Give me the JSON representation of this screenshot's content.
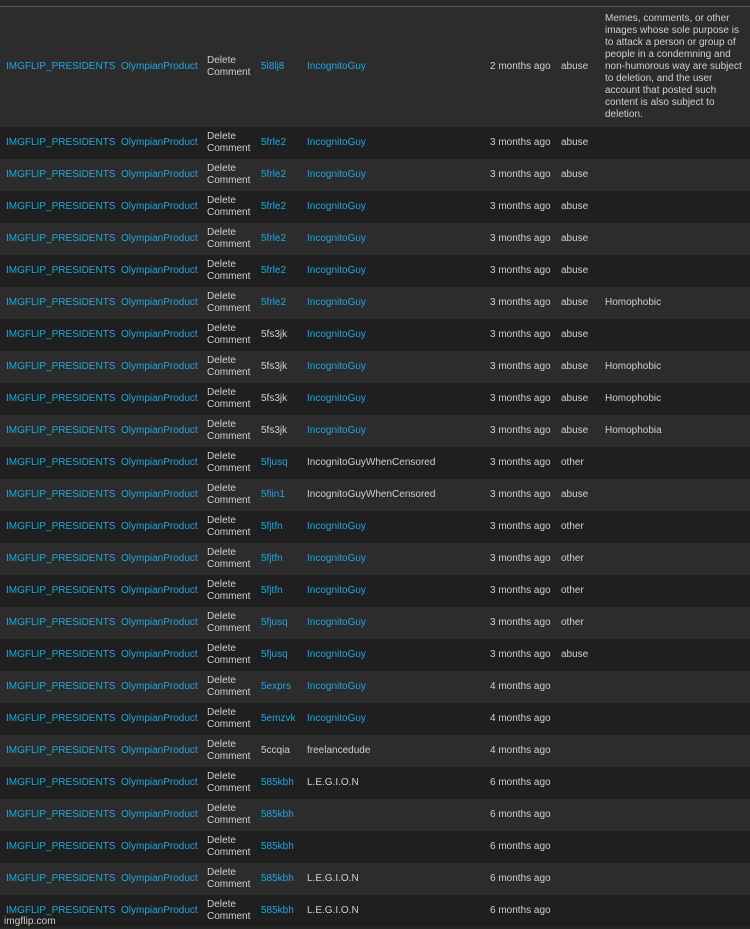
{
  "watermark": "imgflip.com",
  "rows": [
    {
      "stream": "IMGFLIP_PRESIDENTS",
      "mod": "OlympianProduct",
      "action": "Delete Comment",
      "post": "5l8lj8",
      "post_link": true,
      "author": "IncognitoGuy",
      "author_link": true,
      "time": "2 months ago",
      "type": "abuse",
      "reason": "Memes, comments, or other images whose sole purpose is to attack a person or group of people in a condemning and non-humorous way are subject to deletion, and the user account that posted such content is also subject to deletion."
    },
    {
      "stream": "IMGFLIP_PRESIDENTS",
      "mod": "OlympianProduct",
      "action": "Delete Comment",
      "post": "5frle2",
      "post_link": true,
      "author": "IncognitoGuy",
      "author_link": true,
      "time": "3 months ago",
      "type": "abuse",
      "reason": ""
    },
    {
      "stream": "IMGFLIP_PRESIDENTS",
      "mod": "OlympianProduct",
      "action": "Delete Comment",
      "post": "5frle2",
      "post_link": true,
      "author": "IncognitoGuy",
      "author_link": true,
      "time": "3 months ago",
      "type": "abuse",
      "reason": ""
    },
    {
      "stream": "IMGFLIP_PRESIDENTS",
      "mod": "OlympianProduct",
      "action": "Delete Comment",
      "post": "5frle2",
      "post_link": true,
      "author": "IncognitoGuy",
      "author_link": true,
      "time": "3 months ago",
      "type": "abuse",
      "reason": ""
    },
    {
      "stream": "IMGFLIP_PRESIDENTS",
      "mod": "OlympianProduct",
      "action": "Delete Comment",
      "post": "5frle2",
      "post_link": true,
      "author": "IncognitoGuy",
      "author_link": true,
      "time": "3 months ago",
      "type": "abuse",
      "reason": ""
    },
    {
      "stream": "IMGFLIP_PRESIDENTS",
      "mod": "OlympianProduct",
      "action": "Delete Comment",
      "post": "5frle2",
      "post_link": true,
      "author": "IncognitoGuy",
      "author_link": true,
      "time": "3 months ago",
      "type": "abuse",
      "reason": ""
    },
    {
      "stream": "IMGFLIP_PRESIDENTS",
      "mod": "OlympianProduct",
      "action": "Delete Comment",
      "post": "5frle2",
      "post_link": true,
      "author": "IncognitoGuy",
      "author_link": true,
      "time": "3 months ago",
      "type": "abuse",
      "reason": "Homophobic"
    },
    {
      "stream": "IMGFLIP_PRESIDENTS",
      "mod": "OlympianProduct",
      "action": "Delete Comment",
      "post": "5fs3jk",
      "post_link": false,
      "author": "IncognitoGuy",
      "author_link": true,
      "time": "3 months ago",
      "type": "abuse",
      "reason": ""
    },
    {
      "stream": "IMGFLIP_PRESIDENTS",
      "mod": "OlympianProduct",
      "action": "Delete Comment",
      "post": "5fs3jk",
      "post_link": false,
      "author": "IncognitoGuy",
      "author_link": true,
      "time": "3 months ago",
      "type": "abuse",
      "reason": "Homophobic"
    },
    {
      "stream": "IMGFLIP_PRESIDENTS",
      "mod": "OlympianProduct",
      "action": "Delete Comment",
      "post": "5fs3jk",
      "post_link": false,
      "author": "IncognitoGuy",
      "author_link": true,
      "time": "3 months ago",
      "type": "abuse",
      "reason": "Homophobic"
    },
    {
      "stream": "IMGFLIP_PRESIDENTS",
      "mod": "OlympianProduct",
      "action": "Delete Comment",
      "post": "5fs3jk",
      "post_link": false,
      "author": "IncognitoGuy",
      "author_link": true,
      "time": "3 months ago",
      "type": "abuse",
      "reason": "Homophobia"
    },
    {
      "stream": "IMGFLIP_PRESIDENTS",
      "mod": "OlympianProduct",
      "action": "Delete Comment",
      "post": "5fjusq",
      "post_link": true,
      "author": "IncognitoGuyWhenCensored",
      "author_link": false,
      "time": "3 months ago",
      "type": "other",
      "reason": ""
    },
    {
      "stream": "IMGFLIP_PRESIDENTS",
      "mod": "OlympianProduct",
      "action": "Delete Comment",
      "post": "5fiin1",
      "post_link": true,
      "author": "IncognitoGuyWhenCensored",
      "author_link": false,
      "time": "3 months ago",
      "type": "abuse",
      "reason": ""
    },
    {
      "stream": "IMGFLIP_PRESIDENTS",
      "mod": "OlympianProduct",
      "action": "Delete Comment",
      "post": "5fjtfn",
      "post_link": true,
      "author": "IncognitoGuy",
      "author_link": true,
      "time": "3 months ago",
      "type": "other",
      "reason": ""
    },
    {
      "stream": "IMGFLIP_PRESIDENTS",
      "mod": "OlympianProduct",
      "action": "Delete Comment",
      "post": "5fjtfn",
      "post_link": true,
      "author": "IncognitoGuy",
      "author_link": true,
      "time": "3 months ago",
      "type": "other",
      "reason": ""
    },
    {
      "stream": "IMGFLIP_PRESIDENTS",
      "mod": "OlympianProduct",
      "action": "Delete Comment",
      "post": "5fjtfn",
      "post_link": true,
      "author": "IncognitoGuy",
      "author_link": true,
      "time": "3 months ago",
      "type": "other",
      "reason": ""
    },
    {
      "stream": "IMGFLIP_PRESIDENTS",
      "mod": "OlympianProduct",
      "action": "Delete Comment",
      "post": "5fjusq",
      "post_link": true,
      "author": "IncognitoGuy",
      "author_link": true,
      "time": "3 months ago",
      "type": "other",
      "reason": ""
    },
    {
      "stream": "IMGFLIP_PRESIDENTS",
      "mod": "OlympianProduct",
      "action": "Delete Comment",
      "post": "5fjusq",
      "post_link": true,
      "author": "IncognitoGuy",
      "author_link": true,
      "time": "3 months ago",
      "type": "abuse",
      "reason": ""
    },
    {
      "stream": "IMGFLIP_PRESIDENTS",
      "mod": "OlympianProduct",
      "action": "Delete Comment",
      "post": "5exprs",
      "post_link": true,
      "author": "IncognitoGuy",
      "author_link": true,
      "time": "4 months ago",
      "type": "",
      "reason": ""
    },
    {
      "stream": "IMGFLIP_PRESIDENTS",
      "mod": "OlympianProduct",
      "action": "Delete Comment",
      "post": "5emzvk",
      "post_link": true,
      "author": "IncognitoGuy",
      "author_link": true,
      "time": "4 months ago",
      "type": "",
      "reason": ""
    },
    {
      "stream": "IMGFLIP_PRESIDENTS",
      "mod": "OlympianProduct",
      "action": "Delete Comment",
      "post": "5ccqia",
      "post_link": false,
      "author": "freelancedude",
      "author_link": false,
      "time": "4 months ago",
      "type": "",
      "reason": ""
    },
    {
      "stream": "IMGFLIP_PRESIDENTS",
      "mod": "OlympianProduct",
      "action": "Delete Comment",
      "post": "585kbh",
      "post_link": true,
      "author": "L.E.G.I.O.N",
      "author_link": false,
      "time": "6 months ago",
      "type": "",
      "reason": ""
    },
    {
      "stream": "IMGFLIP_PRESIDENTS",
      "mod": "OlympianProduct",
      "action": "Delete Comment",
      "post": "585kbh",
      "post_link": true,
      "author": "",
      "author_link": false,
      "time": "6 months ago",
      "type": "",
      "reason": ""
    },
    {
      "stream": "IMGFLIP_PRESIDENTS",
      "mod": "OlympianProduct",
      "action": "Delete Comment",
      "post": "585kbh",
      "post_link": true,
      "author": "",
      "author_link": false,
      "time": "6 months ago",
      "type": "",
      "reason": ""
    },
    {
      "stream": "IMGFLIP_PRESIDENTS",
      "mod": "OlympianProduct",
      "action": "Delete Comment",
      "post": "585kbh",
      "post_link": true,
      "author": "L.E.G.I.O.N",
      "author_link": false,
      "time": "6 months ago",
      "type": "",
      "reason": ""
    },
    {
      "stream": "IMGFLIP_PRESIDENTS",
      "mod": "OlympianProduct",
      "action": "Delete Comment",
      "post": "585kbh",
      "post_link": true,
      "author": "L.E.G.I.O.N",
      "author_link": false,
      "time": "6 months ago",
      "type": "",
      "reason": ""
    }
  ]
}
